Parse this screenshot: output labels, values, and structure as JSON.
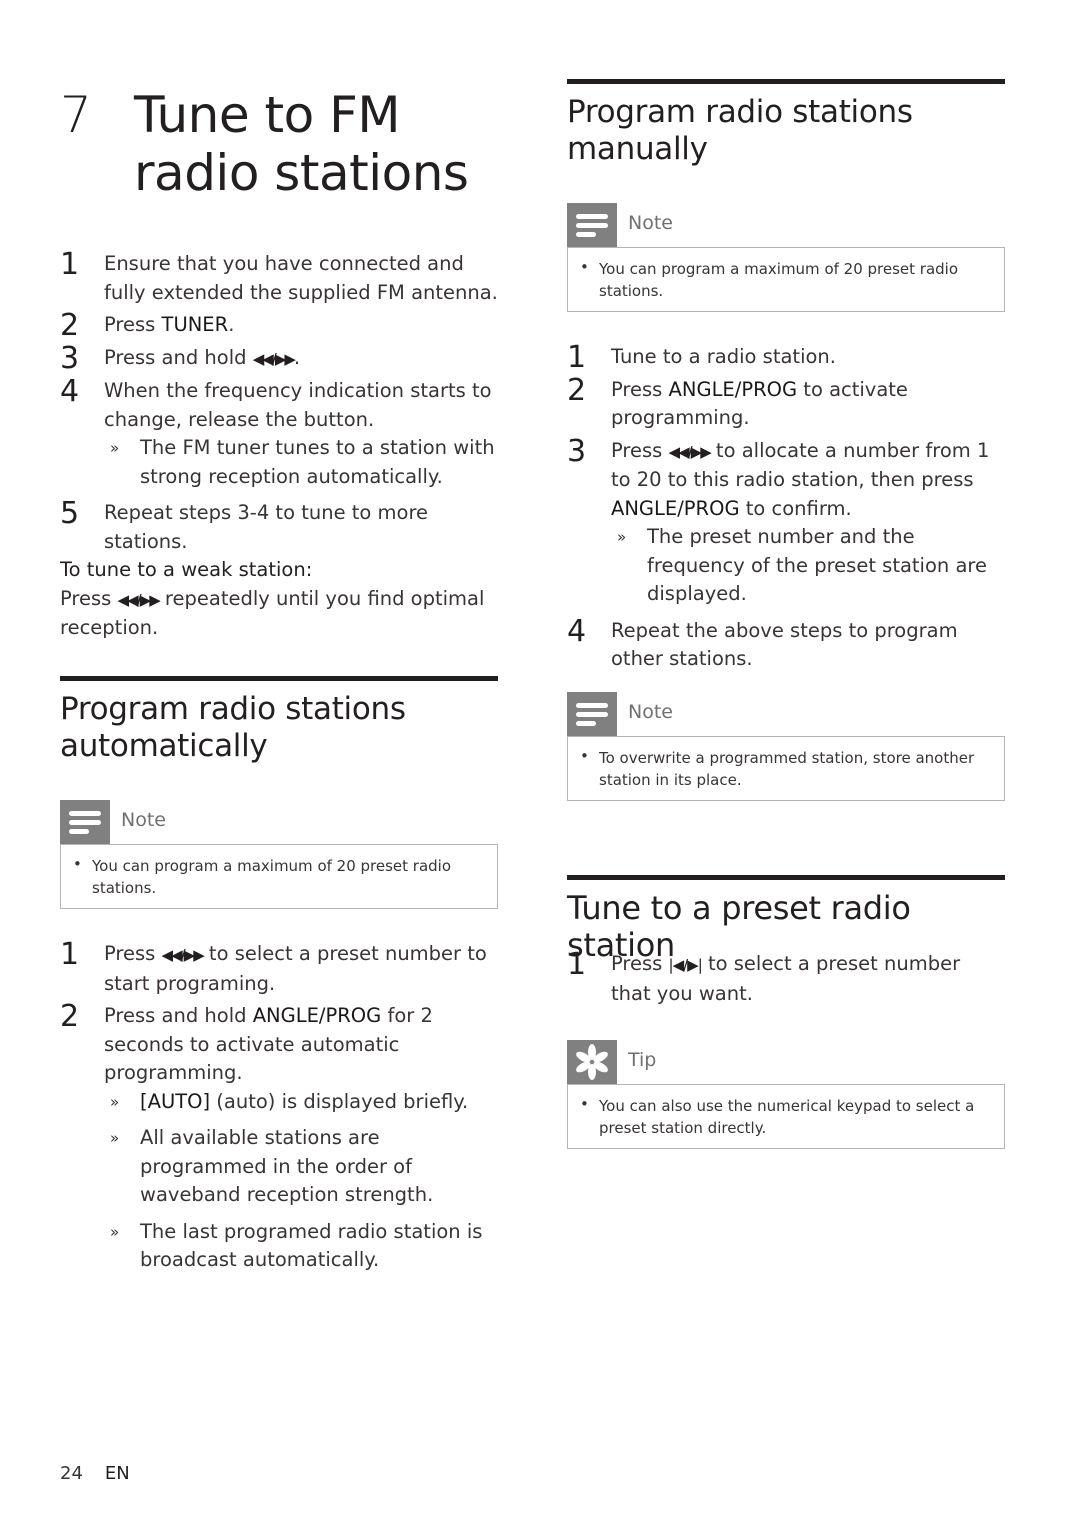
{
  "chapter": {
    "number": "7",
    "title": "Tune to FM radio stations"
  },
  "intro_steps": [
    {
      "num": "1",
      "text": "Ensure that you have connected and fully extended the supplied FM antenna."
    },
    {
      "num": "2",
      "pre": "Press ",
      "bold": "TUNER",
      "post": "."
    },
    {
      "num": "3",
      "pre": "Press and hold ",
      "control": "◀◀/▶▶",
      "post": "."
    },
    {
      "num": "4",
      "text": "When the frequency indication starts to change, release the button.",
      "result": "The FM tuner tunes to a station with strong reception automatically."
    },
    {
      "num": "5",
      "text": "Repeat steps 3-4 to tune to more stations."
    }
  ],
  "weak_station": {
    "heading": "To tune to a weak station:",
    "pre": "Press ",
    "control": "◀◀/▶▶",
    "post": " repeatedly until you find optimal reception."
  },
  "auto_section": {
    "title": "Program radio stations automatically",
    "note": {
      "label": "Note",
      "icon": "note-icon",
      "text": "You can program a maximum of 20 preset radio stations."
    },
    "steps": [
      {
        "num": "1",
        "pre": "Press ",
        "control": "◀◀/▶▶",
        "post": " to select a preset number to start programing."
      },
      {
        "num": "2",
        "pre": "Press and hold ",
        "bold": "ANGLE/PROG",
        "post": " for 2 seconds to activate automatic programming."
      }
    ],
    "results": [
      {
        "bold": "[AUTO]",
        "text": " (auto) is displayed briefly."
      },
      {
        "text": "All available stations are programmed in the order of waveband reception strength."
      },
      {
        "text": "The last programed radio station is broadcast automatically."
      }
    ]
  },
  "manual_section": {
    "title": "Program radio stations manually",
    "note": {
      "label": "Note",
      "icon": "note-icon",
      "text": "You can program a maximum of 20 preset radio stations."
    },
    "steps": [
      {
        "num": "1",
        "text": "Tune to a radio station."
      },
      {
        "num": "2",
        "pre": "Press ",
        "bold": "ANGLE/PROG",
        "post": " to activate programming."
      },
      {
        "num": "3",
        "pre": "Press ",
        "control": "◀◀/▶▶",
        "mid": " to allocate a number from 1 to 20 to this radio station, then press ",
        "bold": "ANGLE/PROG",
        "post": " to confirm.",
        "result": "The preset number and the frequency of the preset station are displayed."
      },
      {
        "num": "4",
        "text": "Repeat the above steps to program other stations."
      }
    ],
    "note2": {
      "label": "Note",
      "icon": "note-icon",
      "text": "To overwrite a programmed station, store another station in its place."
    }
  },
  "preset_section": {
    "title": "Tune to a preset radio station",
    "steps": [
      {
        "num": "1",
        "pre": "Press ",
        "control": "|◀/▶|",
        "post": " to select a preset number that you want."
      }
    ],
    "tip": {
      "label": "Tip",
      "icon": "tip-icon",
      "text": "You can also use the numerical keypad to select a preset station directly."
    }
  },
  "footer": {
    "page_number": "24",
    "language": "EN"
  },
  "colors": {
    "text": "#3a3334",
    "heading": "#231f20",
    "note_icon_bg": "#808080",
    "note_border": "#b5b5b5"
  }
}
